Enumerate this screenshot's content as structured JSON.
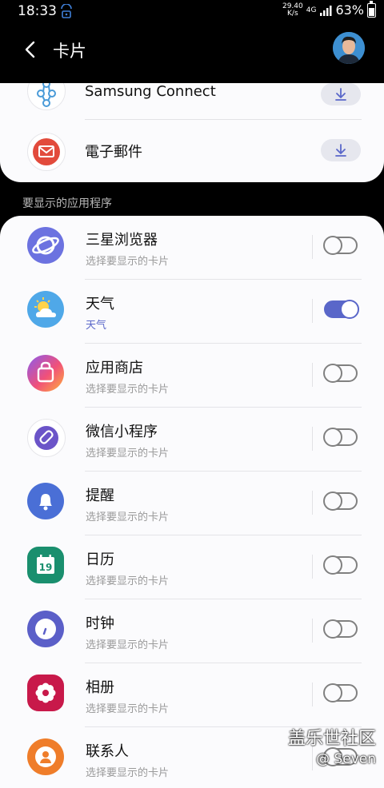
{
  "status_bar": {
    "time": "18:33",
    "speed_value": "29.40",
    "speed_unit": "K/s",
    "network": "4G",
    "battery": "63%"
  },
  "header": {
    "title": "卡片"
  },
  "download_section": {
    "items": [
      {
        "label": "Samsung Connect",
        "icon": "samsung-connect-icon"
      },
      {
        "label": "電子郵件",
        "icon": "email-icon"
      }
    ]
  },
  "section_label": "要显示的应用程序",
  "apps": [
    {
      "name": "三星浏览器",
      "subtitle": "选择要显示的卡片",
      "enabled": false,
      "icon": "samsung-internet-icon",
      "color": "#6c72e0"
    },
    {
      "name": "天气",
      "subtitle": "天气",
      "enabled": true,
      "icon": "weather-icon",
      "color": "#4fa8e8"
    },
    {
      "name": "应用商店",
      "subtitle": "选择要显示的卡片",
      "enabled": false,
      "icon": "galaxy-store-icon",
      "color": "#e85c8a"
    },
    {
      "name": "微信小程序",
      "subtitle": "选择要显示的卡片",
      "enabled": false,
      "icon": "wechat-mini-program-icon",
      "color": "#6b54c8"
    },
    {
      "name": "提醒",
      "subtitle": "选择要显示的卡片",
      "enabled": false,
      "icon": "reminder-icon",
      "color": "#4a6fd6"
    },
    {
      "name": "日历",
      "subtitle": "选择要显示的卡片",
      "enabled": false,
      "icon": "calendar-icon",
      "color": "#1a8f6e",
      "icon_text": "19"
    },
    {
      "name": "时钟",
      "subtitle": "选择要显示的卡片",
      "enabled": false,
      "icon": "clock-icon",
      "color": "#5b5fc8"
    },
    {
      "name": "相册",
      "subtitle": "选择要显示的卡片",
      "enabled": false,
      "icon": "gallery-icon",
      "color": "#c8194a"
    },
    {
      "name": "联系人",
      "subtitle": "选择要显示的卡片",
      "enabled": false,
      "icon": "contacts-icon",
      "color": "#ef7d2a"
    }
  ],
  "watermark": {
    "line1": "盖乐世社区",
    "line2": "@ Seven"
  },
  "colors": {
    "accent": "#5a67c9",
    "background": "#000000",
    "card": "#fbfbfd"
  }
}
